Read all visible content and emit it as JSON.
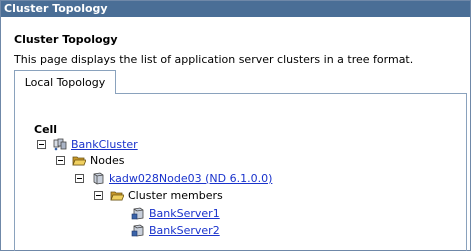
{
  "window": {
    "title": "Cluster Topology"
  },
  "page": {
    "heading": "Cluster Topology",
    "description": "This page displays the list of application server clusters in a tree format."
  },
  "tabs": [
    {
      "label": "Local Topology",
      "active": true
    }
  ],
  "tree": {
    "root_label": "Cell",
    "cluster": {
      "label": "BankCluster",
      "icon": "cluster-icon",
      "expanded": true
    },
    "nodes_folder": {
      "label": "Nodes",
      "icon": "folder-open-icon",
      "expanded": true
    },
    "node": {
      "label": "kadw028Node03 (ND 6.1.0.0)",
      "icon": "node-icon",
      "expanded": true
    },
    "members_folder": {
      "label": "Cluster members",
      "icon": "folder-open-icon",
      "expanded": true
    },
    "servers": [
      {
        "label": "BankServer1",
        "icon": "server-icon"
      },
      {
        "label": "BankServer2",
        "icon": "server-icon"
      }
    ]
  },
  "colors": {
    "titlebar": "#4a6e96",
    "link": "#1a33cc",
    "folder": "#e8c24a"
  }
}
